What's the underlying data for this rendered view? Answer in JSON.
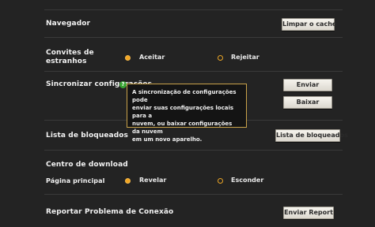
{
  "settings": {
    "navegador": {
      "label": "Navegador",
      "button": "Limpar o cache"
    },
    "convites": {
      "label_line1": "Convites de",
      "label_line2": "estranhos",
      "option_accept": "Aceitar",
      "option_reject": "Rejeitar",
      "selected": "Aceitar"
    },
    "sincronizar": {
      "label": "Sincronizar configurações",
      "help_glyph": "?",
      "send_button": "Enviar",
      "download_button": "Baixar",
      "tooltip_lines": [
        "A sincronização de configurações pode",
        "enviar suas configurações locais para a",
        "nuvem, ou baixar configurações da nuvem",
        "em um novo aparelho."
      ]
    },
    "bloqueados": {
      "label": "Lista de bloqueados",
      "button": "Lista de bloqueados"
    },
    "download_center": {
      "heading": "Centro de download",
      "row_label": "Página principal",
      "option_reveal": "Revelar",
      "option_hide": "Esconder",
      "selected": "Revelar"
    },
    "report": {
      "label": "Reportar Problema de Conexão",
      "button": "Enviar Report"
    }
  },
  "colors": {
    "background": "#232323",
    "accent_radio": "#f2a623",
    "tooltip_border": "#c9a24a",
    "help_badge": "#3aa635"
  }
}
